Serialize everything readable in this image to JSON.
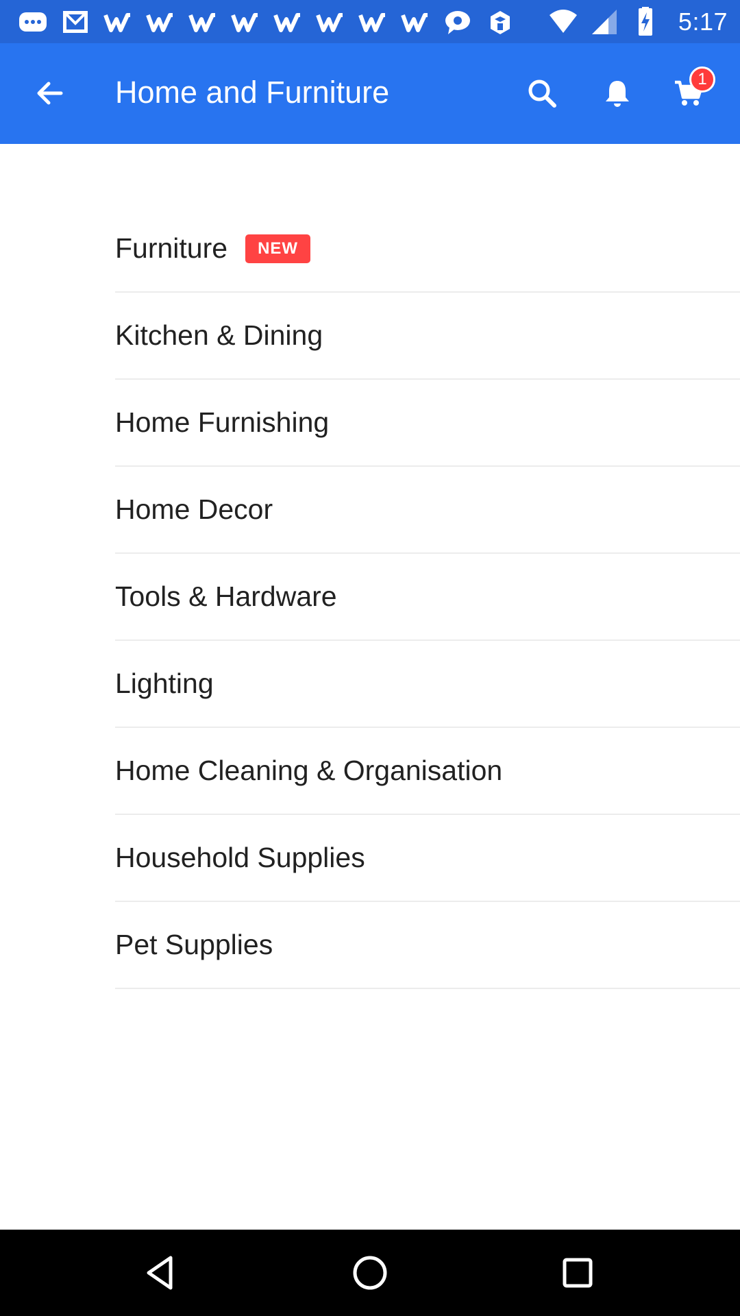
{
  "status_bar": {
    "time": "5:17",
    "notification_icons": [
      "messenger-icon",
      "gmail-icon",
      "w-app-icon",
      "w-app-icon",
      "w-app-icon",
      "w-app-icon",
      "w-app-icon",
      "w-app-icon",
      "w-app-icon",
      "w-app-icon",
      "chat-icon",
      "myntra-icon"
    ],
    "system_icons": [
      "wifi-icon",
      "signal-icon",
      "battery-charging-icon"
    ]
  },
  "app_bar": {
    "title": "Home and Furniture",
    "cart_count": "1",
    "icons": [
      "back-arrow-icon",
      "search-icon",
      "bell-icon",
      "cart-icon"
    ]
  },
  "categories": [
    {
      "label": "Furniture",
      "badge": "NEW"
    },
    {
      "label": "Kitchen & Dining"
    },
    {
      "label": "Home Furnishing"
    },
    {
      "label": "Home Decor"
    },
    {
      "label": "Tools & Hardware"
    },
    {
      "label": "Lighting"
    },
    {
      "label": "Home Cleaning & Organisation"
    },
    {
      "label": "Household Supplies"
    },
    {
      "label": "Pet Supplies"
    }
  ],
  "colors": {
    "status_bar": "#2565d6",
    "app_bar": "#2874f0",
    "badge_red": "#ff4343",
    "text": "#212121"
  },
  "nav_bar": {
    "icons": [
      "back-triangle-icon",
      "home-circle-icon",
      "recents-square-icon"
    ]
  }
}
